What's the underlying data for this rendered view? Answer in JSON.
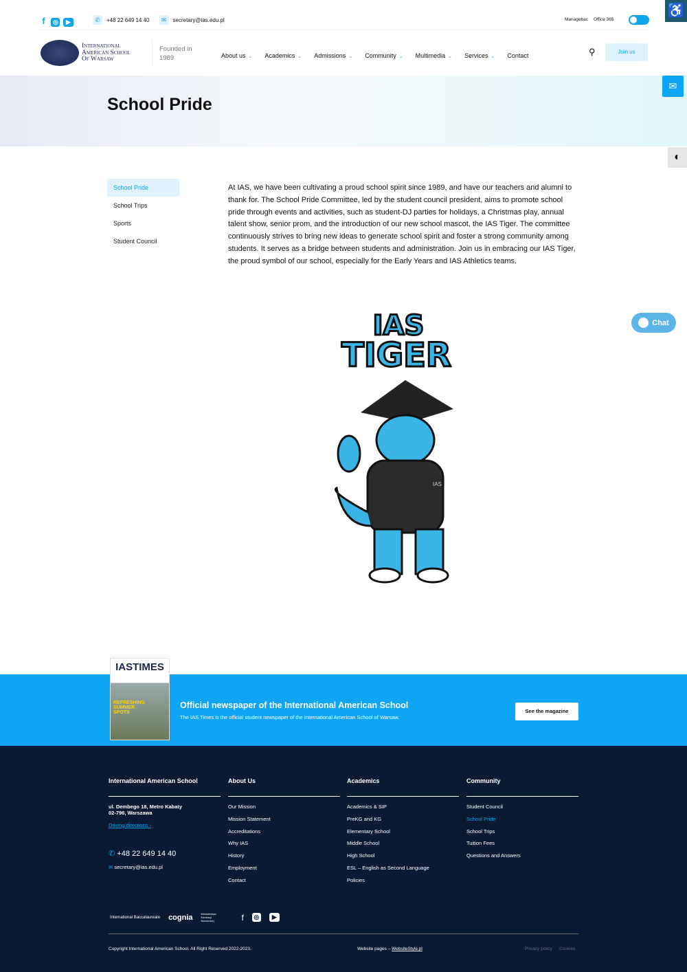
{
  "topbar": {
    "phone": "+48 22 649 14 40",
    "email": "secretary@ias.edu.pl",
    "links": [
      "Managebac",
      "Office 365"
    ],
    "icons": [
      "facebook-icon",
      "instagram-icon",
      "youtube-icon"
    ]
  },
  "header": {
    "logo_text": [
      "International",
      "American School",
      "Of Warsaw"
    ],
    "founded_label": "Founded in",
    "founded_year": "1989",
    "nav": [
      "About us",
      "Academics",
      "Admissions",
      "Community",
      "Multimedia",
      "Services",
      "Contact"
    ],
    "join": "Join us"
  },
  "hero": {
    "title": "School Pride"
  },
  "sidebar": {
    "items": [
      "School Pride",
      "School Trips",
      "Sports",
      "Student Council"
    ]
  },
  "content": {
    "text": "At IAS, we have been cultivating a proud school spirit since 1989, and have our teachers and alumni to thank for. The School Pride Committee, led by the student council president, aims to promote school pride through events and activities, such as student-DJ parties for holidays, a Christmas play, annual talent show, senior prom, and the introduction of our new school mascot, the IAS Tiger. The committee continuously strives to bring new ideas to generate school spirit and foster a strong community among students. It serves as a bridge between students and administration. Join us in embracing our IAS Tiger, the proud symbol of our school, especially for the Early Years and IAS Athletics teams.",
    "mascot_text": [
      "IAS",
      "TIGER"
    ],
    "mascot_badge": "IAS"
  },
  "chat": "Chat",
  "newspaper": {
    "cover_title": "IASTIMES",
    "cover_headline": "REFRESHING SUMMER SPOTS",
    "title": "Official newspaper of the International American School",
    "subtitle": "The IAS Times is the official student newspaper of the International American School of Warsaw.",
    "button": "See the magazine"
  },
  "footer": {
    "col1": {
      "title": "International American School",
      "address1": "ul. Dembego 18, Metro Kabaty",
      "address2": "02-796, Warszawa",
      "directions": "Driving directions",
      "phone": "+48 22 649 14 40",
      "email": "secretary@ias.edu.pl"
    },
    "col2": {
      "title": "About Us",
      "items": [
        "Our Mission",
        "Mission Statement",
        "Accreditations",
        "Why IAS",
        "History",
        "Employment",
        "Contact"
      ]
    },
    "col3": {
      "title": "Academics",
      "items": [
        "Academics & SIP",
        "PreKG and KG",
        "Elementary School",
        "Middle School",
        "High School",
        "ESL – English as Second Language",
        "Policies"
      ]
    },
    "col4": {
      "title": "Community",
      "items": [
        "Student Council",
        "School Pride",
        "School Trips",
        "Tuition Fees",
        "Questions and Answers"
      ]
    },
    "partners": [
      "International Baccalaureate",
      "cognia",
      "Ministerstwo Edukacji Narodowej"
    ],
    "copyright": "Copyright International American School. All Right Reserved 2022-2023.",
    "credits_label": "Website pages –",
    "credits_link": "WebsiteStyle.pl",
    "legal": [
      "Privacy policy",
      "Cookies"
    ]
  },
  "colors": {
    "accent": "#0ea5e9",
    "footer_bg": "#0a1a33"
  }
}
